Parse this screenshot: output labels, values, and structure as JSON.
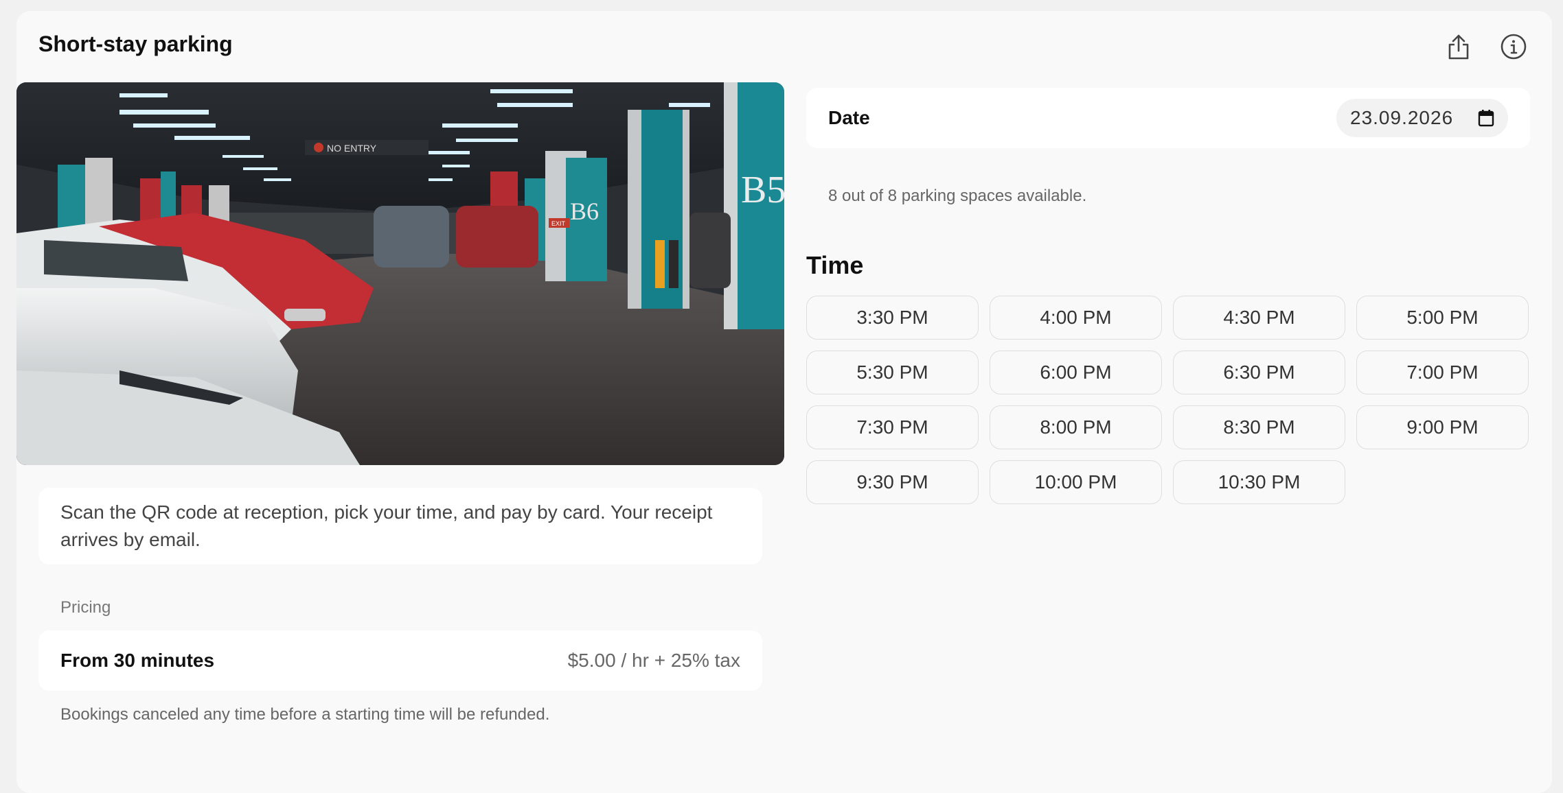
{
  "header": {
    "title": "Short-stay parking",
    "share_icon": "share-icon",
    "info_icon": "info-icon"
  },
  "photo": {
    "signs": [
      "NO ENTRY",
      "B5",
      "B6",
      "EXIT"
    ]
  },
  "description": "Scan the QR code at reception, pick your time, and pay by card. Your receipt arrives by email.",
  "pricing": {
    "section_label": "Pricing",
    "item_name": "From 30 minutes",
    "item_price": "$5.00 / hr + 25% tax",
    "refund_note": "Bookings canceled any time before a starting time will be refunded."
  },
  "date": {
    "label": "Date",
    "value": "23.09.2026",
    "icon": "calendar-icon"
  },
  "availability": "8 out of 8 parking spaces available.",
  "time": {
    "title": "Time",
    "slots": [
      "3:30 PM",
      "4:00 PM",
      "4:30 PM",
      "5:00 PM",
      "5:30 PM",
      "6:00 PM",
      "6:30 PM",
      "7:00 PM",
      "7:30 PM",
      "8:00 PM",
      "8:30 PM",
      "9:00 PM",
      "9:30 PM",
      "10:00 PM",
      "10:30 PM"
    ]
  },
  "colors": {
    "page_bg": "#f1f1f1",
    "card_bg": "#f9f9f9",
    "box_bg": "#ffffff",
    "slot_border": "#dedede",
    "accent_teal": "#1e8a92",
    "accent_red": "#b52b32"
  }
}
